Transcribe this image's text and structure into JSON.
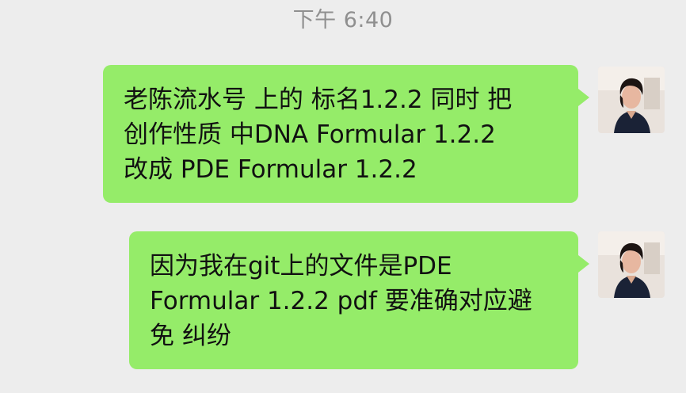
{
  "chat": {
    "timestamp": "下午 6:40",
    "messages": [
      {
        "sender": "me",
        "lines": [
          "老陈流水号 上的 标名1.2.2 同时 把",
          "创作性质  中DNA Formular 1.2.2",
          "改成 PDE Formular 1.2.2"
        ]
      },
      {
        "sender": "me",
        "lines": [
          "因为我在git上的文件是PDE",
          "Formular 1.2.2 pdf 要准确对应避",
          "免 纠纷"
        ]
      }
    ]
  },
  "theme": {
    "background": "#ededed",
    "bubble_color": "#95ec69",
    "timestamp_color": "#8f8f8f",
    "text_color": "#111111"
  }
}
